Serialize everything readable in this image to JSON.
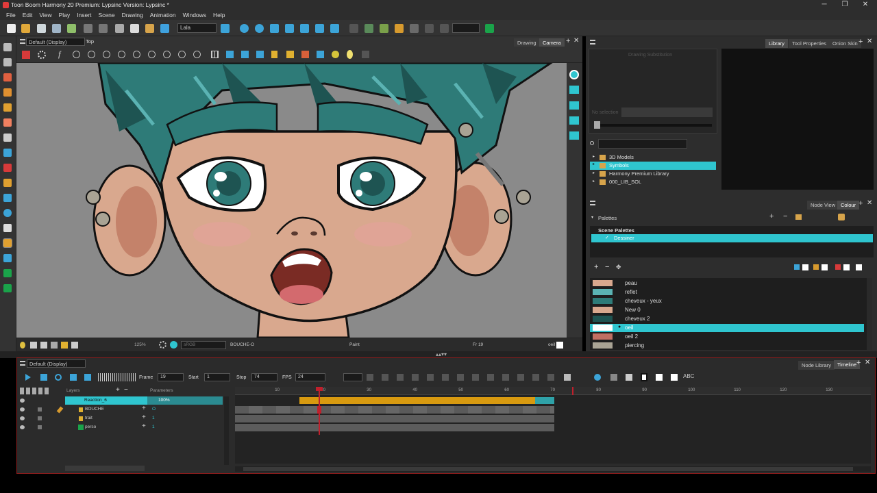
{
  "window": {
    "title": "Toon Boom Harmony 20 Premium: Lypsinc Version: Lypsinc *"
  },
  "menu": [
    "File",
    "Edit",
    "View",
    "Play",
    "Insert",
    "Scene",
    "Drawing",
    "Animation",
    "Windows",
    "Help"
  ],
  "toolbar": {
    "layer_select": "Lala"
  },
  "viewport": {
    "workspace": "Default (Display)",
    "view_mode": "Top",
    "tabs": [
      "Drawing",
      "Camera"
    ],
    "status": {
      "zoom": "125%",
      "colorspace": "sRGB",
      "layer": "BOUCHE-O",
      "tool": "Paint",
      "frame": "Fr 19",
      "colour": "oeil"
    }
  },
  "right_top": {
    "tabs": [
      "Library",
      "Tool Properties",
      "Onion Skin"
    ],
    "drawing_substitution": "Drawing Substitution",
    "no_selection": "No selection",
    "library_tree": [
      "3D Models",
      "Symbols",
      "Harmony Premium Library",
      "000_LIB_SOL"
    ]
  },
  "right_bottom": {
    "tabs": [
      "Node View",
      "Colour"
    ],
    "palettes_label": "Palettes",
    "scene_palettes": "Scene Palettes",
    "active_palette": "Dessiner",
    "colours": [
      {
        "name": "peau",
        "hex": "#d9a88e"
      },
      {
        "name": "reflet",
        "hex": "#5bb3b3"
      },
      {
        "name": "cheveux - yeux",
        "hex": "#2e7b78"
      },
      {
        "name": "New 0",
        "hex": "#d9a88e"
      },
      {
        "name": "cheveux 2",
        "hex": "#1e5452"
      },
      {
        "name": "oeil",
        "hex": "#ffffff"
      },
      {
        "name": "oeil 2",
        "hex": "#c06f63"
      },
      {
        "name": "piercing",
        "hex": "#a9a394"
      }
    ]
  },
  "timeline": {
    "workspace": "Default (Display)",
    "tabs": [
      "Node Library",
      "Timeline"
    ],
    "frame_label": "Frame",
    "frame": "19",
    "start_label": "Start",
    "start": "1",
    "stop_label": "Stop",
    "stop": "74",
    "fps_label": "FPS",
    "fps": "24",
    "layers_header": "Layers",
    "params_header": "Parameters",
    "ticks": [
      "10",
      "20",
      "30",
      "40",
      "50",
      "60",
      "70",
      "80",
      "90",
      "100",
      "110",
      "120",
      "130"
    ],
    "layers": [
      {
        "name": "Reaction_6",
        "param": "100%"
      },
      {
        "name": "BOUCHE",
        "param": "O"
      },
      {
        "name": "trait",
        "param": "1"
      },
      {
        "name": "perso",
        "param": "1"
      }
    ],
    "current_frame": 19,
    "scene_end": 74
  },
  "colors": {
    "accent": "#2fc5cf",
    "timeline_bar": "#d89a10",
    "playhead": "#c0202c"
  }
}
